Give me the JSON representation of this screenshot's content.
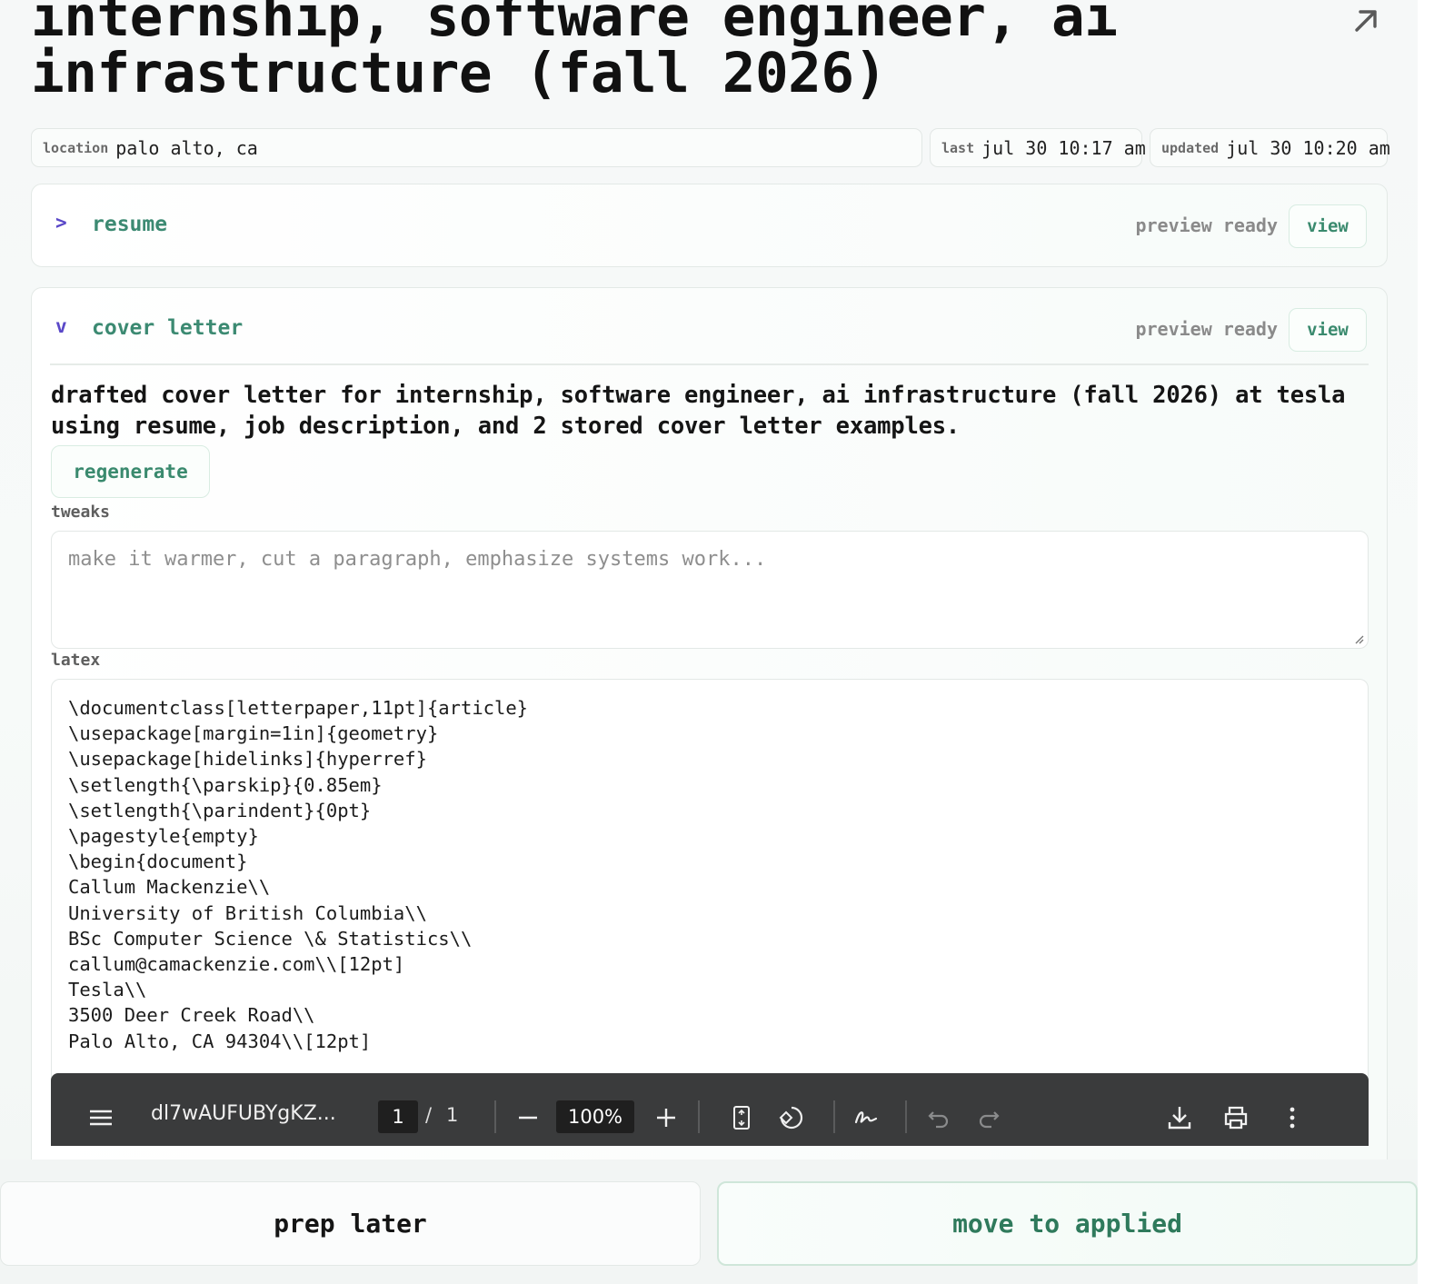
{
  "job": {
    "title": "internship, software engineer, ai infrastructure (fall 2026)"
  },
  "meta": {
    "location_key": "location",
    "location_value": "palo alto, ca",
    "last_key": "last",
    "last_value": "jul 30 10:17 am",
    "updated_key": "updated",
    "updated_value": "jul 30 10:20 am"
  },
  "resume": {
    "chevron": ">",
    "title": "resume",
    "status": "preview ready",
    "view_label": "view"
  },
  "cover_letter": {
    "chevron": "v",
    "title": "cover letter",
    "status": "preview ready",
    "view_label": "view",
    "summary": "drafted cover letter for internship, software engineer, ai infrastructure (fall 2026) at tesla using resume, job description, and 2 stored cover letter examples.",
    "regenerate_label": "regenerate",
    "tweaks_label": "tweaks",
    "tweaks_placeholder": "make it warmer, cut a paragraph, emphasize systems work...",
    "latex_label": "latex",
    "latex_lines": [
      "\\documentclass[letterpaper,11pt]{article}",
      "\\usepackage[margin=1in]{geometry}",
      "\\usepackage[hidelinks]{hyperref}",
      "\\setlength{\\parskip}{0.85em}",
      "\\setlength{\\parindent}{0pt}",
      "\\pagestyle{empty}",
      "\\begin{document}",
      "Callum Mackenzie\\\\",
      "University of British Columbia\\\\",
      "BSc Computer Science \\& Statistics\\\\",
      "callum@camackenzie.com\\\\[12pt]",
      "Tesla\\\\",
      "3500 Deer Creek Road\\\\",
      "Palo Alto, CA 94304\\\\[12pt]"
    ]
  },
  "pdf_viewer": {
    "file_name": "dl7wAUFUBYgKZ...",
    "page_current": "1",
    "page_separator": "/",
    "page_total": "1",
    "zoom": "100%",
    "icons": [
      "menu-icon",
      "zoom-out-icon",
      "zoom-in-icon",
      "fit-page-icon",
      "rotate-icon",
      "annotate-icon",
      "undo-icon",
      "redo-icon",
      "download-icon",
      "print-icon",
      "more-icon"
    ]
  },
  "actions": {
    "prep_later_label": "prep later",
    "move_to_applied_label": "move to applied"
  },
  "colors": {
    "accent_green": "#3a8a6e",
    "chevron_purple": "#5a48c8",
    "pdf_toolbar": "#3a3b3c"
  }
}
